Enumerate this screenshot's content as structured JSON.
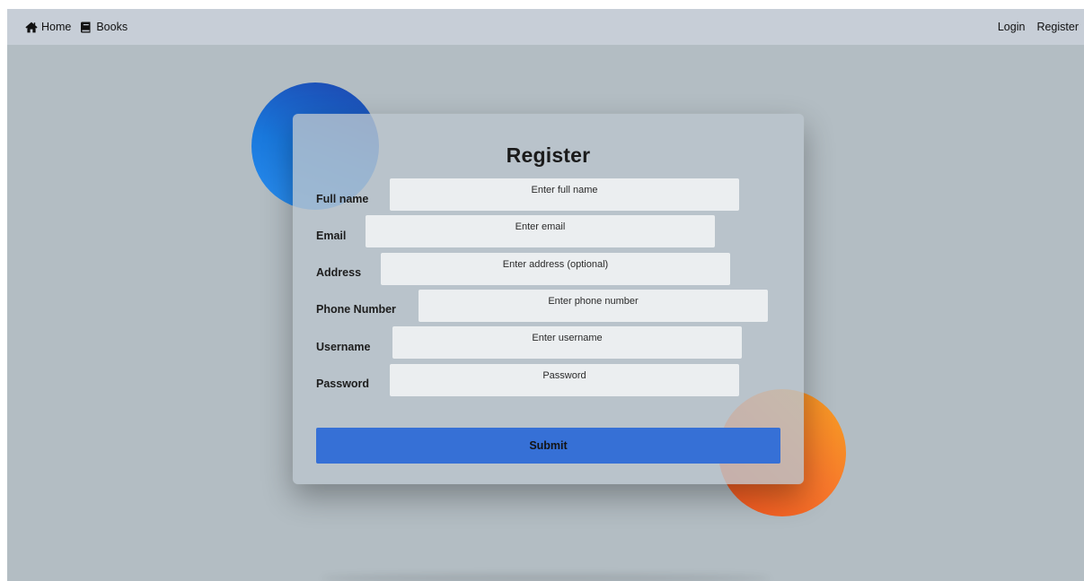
{
  "navbar": {
    "home": {
      "label": "Home",
      "icon": "home-icon"
    },
    "books": {
      "label": "Books",
      "icon": "book-icon"
    },
    "login": {
      "label": "Login"
    },
    "register": {
      "label": "Register"
    }
  },
  "form": {
    "title": "Register",
    "fields": [
      {
        "label": "Full name",
        "placeholder": "Enter full name",
        "value": ""
      },
      {
        "label": "Email",
        "placeholder": "Enter email",
        "value": ""
      },
      {
        "label": "Address",
        "placeholder": "Enter address (optional)",
        "value": ""
      },
      {
        "label": "Phone Number",
        "placeholder": "Enter phone number",
        "value": ""
      },
      {
        "label": "Username",
        "placeholder": "Enter username",
        "value": ""
      },
      {
        "label": "Password",
        "placeholder": "Password",
        "value": ""
      }
    ],
    "submit_label": "Submit"
  },
  "colors": {
    "page_background": "#b3bdc3",
    "navbar_background": "#c7ced7",
    "submit_button": "#3670d6",
    "input_background": "#ebeef0",
    "blue_circle": "#1978dc",
    "orange_circle": "#f7782b"
  }
}
